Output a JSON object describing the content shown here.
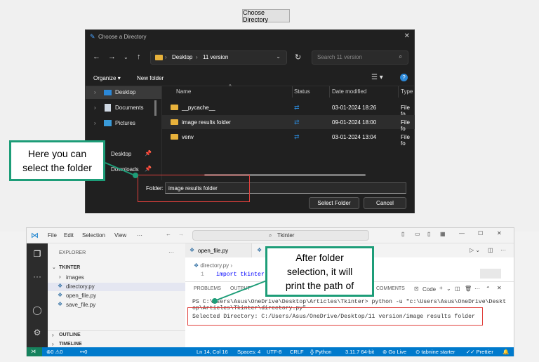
{
  "app": {
    "choose_button": "Choose Directory"
  },
  "dialog": {
    "title": "Choose a Directory",
    "breadcrumb": [
      "Desktop",
      "11 version"
    ],
    "search_placeholder": "Search 11 version",
    "organize": "Organize",
    "new_folder": "New folder",
    "sidebar": [
      {
        "label": "Desktop",
        "selected": true
      },
      {
        "label": "Documents"
      },
      {
        "label": "Pictures"
      },
      {
        "label": "Desktop"
      },
      {
        "label": "Downloads"
      }
    ],
    "columns": {
      "name": "Name",
      "status": "Status",
      "date": "Date modified",
      "type": "Type"
    },
    "rows": [
      {
        "name": "__pycache__",
        "date": "03-01-2024 18:26",
        "type": "File fo"
      },
      {
        "name": "image results folder",
        "date": "09-01-2024 18:00",
        "type": "File fo"
      },
      {
        "name": "venv",
        "date": "03-01-2024 13:04",
        "type": "File fo"
      }
    ],
    "folder_label": "Folder:",
    "folder_value": "image results folder",
    "select_button": "Select Folder",
    "cancel_button": "Cancel"
  },
  "callouts": {
    "left_line1": "Here you can",
    "left_line2": "select the folder",
    "right_line1": "After folder",
    "right_line2": "selection, it will",
    "right_line3": "print the path of"
  },
  "vscode": {
    "menu": [
      "File",
      "Edit",
      "Selection",
      "View",
      "···"
    ],
    "search": "Tkinter",
    "explorer_title": "EXPLORER",
    "folder": "TKINTER",
    "files": [
      "images",
      "directory.py",
      "open_file.py",
      "save_file.py"
    ],
    "outline": "OUTLINE",
    "timeline": "TIMELINE",
    "tabs": [
      "open_file.py",
      "sa"
    ],
    "breadcrumb_file": "directory.py",
    "code_line_no": "1",
    "code_line": "import tkinter",
    "panel_tabs": [
      "PROBLEMS",
      "OUTPUT",
      "COMMENTS"
    ],
    "terminal_kind": "Code",
    "terminal_line1": "PS C:\\Users\\Asus\\OneDrive\\Desktop\\Articles\\Tkinter> python -u \"c:\\Users\\Asus\\OneDrive\\Deskt",
    "terminal_line2": "op\\Articles\\Tkinter\\directory.py\"",
    "terminal_line3": "Selected Directory: C:/Users/Asus/OneDrive/Desktop/11 version/image results folder",
    "status": {
      "errors": "0",
      "warnings": "0",
      "ports": "0",
      "position": "Ln 14, Col 16",
      "spaces": "Spaces: 4",
      "encoding": "UTF-8",
      "eol": "CRLF",
      "language": "Python",
      "interpreter": "3.11.7 64-bit",
      "golive": "Go Live",
      "tabnine": "tabnine starter",
      "prettier": "Prettier"
    }
  },
  "colors": {
    "accent": "#1d9d78",
    "highlight": "#e0403c",
    "statusbar": "#007acc"
  }
}
